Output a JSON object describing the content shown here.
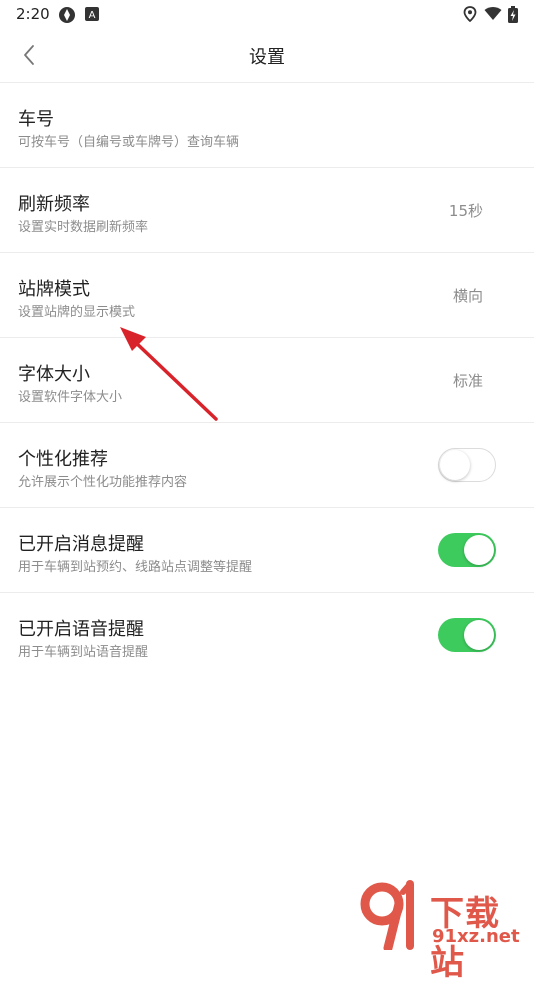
{
  "status": {
    "time": "2:20",
    "icons": [
      "vpn-icon",
      "notification-a-icon",
      "location-icon",
      "wifi-icon",
      "battery-charging-icon"
    ]
  },
  "header": {
    "title": "设置",
    "back_icon": "chevron-left-icon"
  },
  "settings": [
    {
      "title": "车号",
      "subtitle": "可按车号（自编号或车牌号）查询车辆",
      "value": ""
    },
    {
      "title": "刷新频率",
      "subtitle": "设置实时数据刷新频率",
      "value": "15秒"
    },
    {
      "title": "站牌模式",
      "subtitle": "设置站牌的显示模式",
      "value": "横向"
    },
    {
      "title": "字体大小",
      "subtitle": "设置软件字体大小",
      "value": "标准"
    },
    {
      "title": "个性化推荐",
      "subtitle": "允许展示个性化功能推荐内容",
      "toggle": "off"
    },
    {
      "title": "已开启消息提醒",
      "subtitle": "用于车辆到站预约、线路站点调整等提醒",
      "toggle": "on"
    },
    {
      "title": "已开启语音提醒",
      "subtitle": "用于车辆到站语音提醒",
      "toggle": "on"
    }
  ],
  "watermark": {
    "text": "下载站",
    "url": "91xz.net"
  },
  "colors": {
    "toggle_on": "#3ecb5e",
    "arrow": "#d9232a",
    "watermark": "#e0584a"
  }
}
